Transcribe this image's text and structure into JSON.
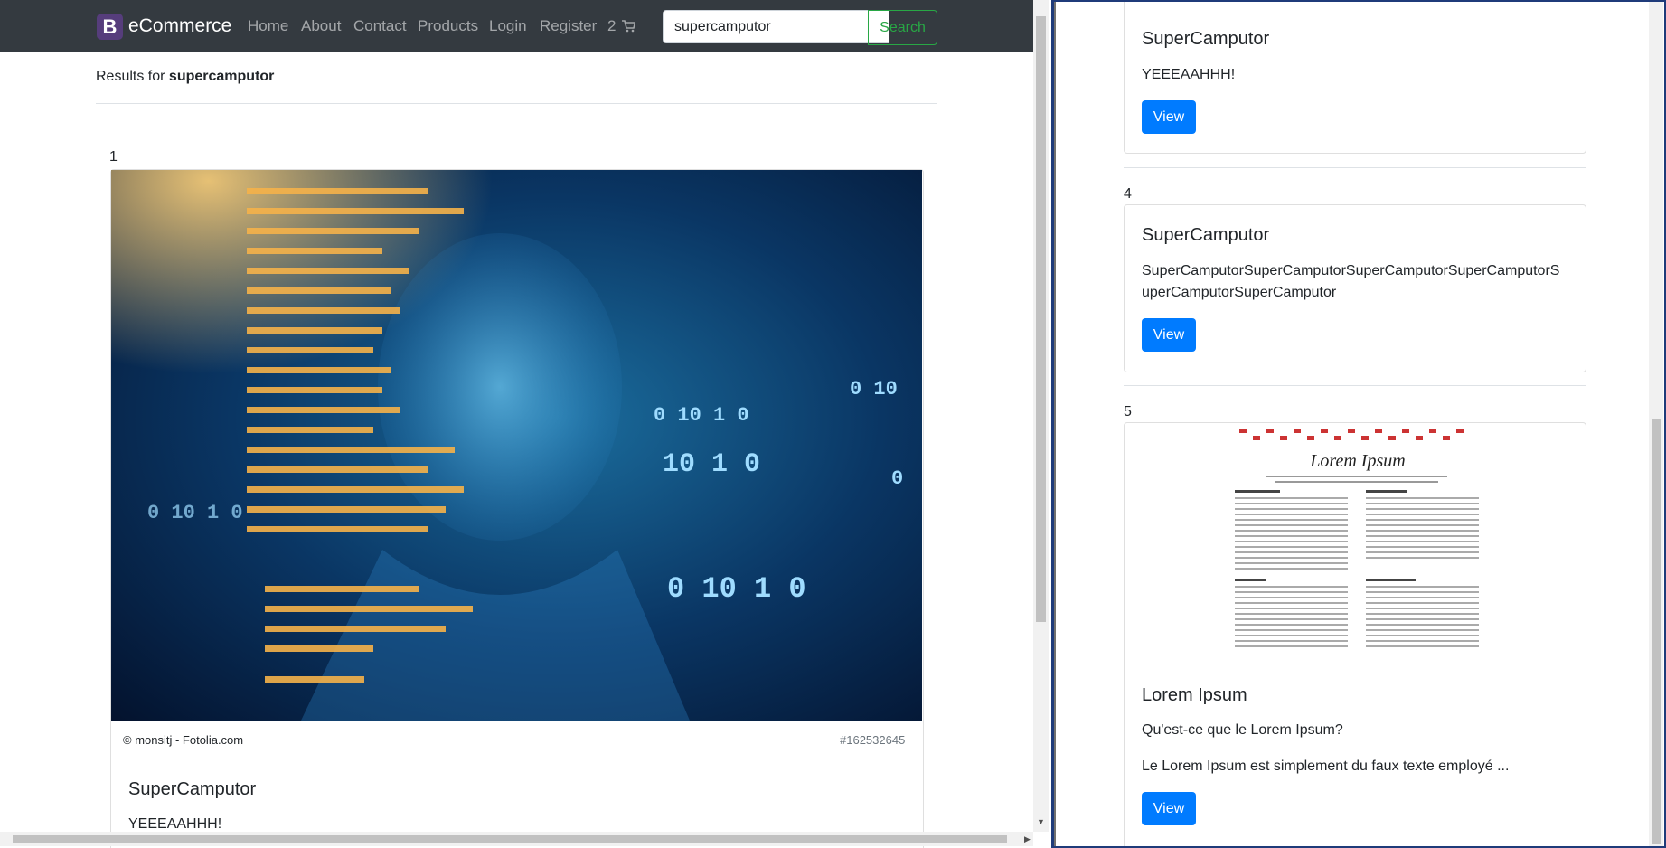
{
  "navbar": {
    "brand_letter": "B",
    "brand_name": "eCommerce",
    "links": [
      "Home",
      "About",
      "Contact",
      "Products",
      "Login",
      "Register"
    ],
    "cart_count": "2",
    "search_value": "supercamputor",
    "search_button": "Search"
  },
  "results": {
    "prefix": "Results for ",
    "query": "supercamputor"
  },
  "left_items": [
    {
      "number": "1",
      "image": "ai-head-code-photo",
      "caption_left": "© monsitj - Fotolia.com",
      "caption_right": "#162532645",
      "title": "SuperCamputor",
      "text": "YEEEAAHHH!"
    }
  ],
  "right_items": [
    {
      "title": "SuperCamputor",
      "text": "YEEEAAHHH!",
      "button": "View"
    },
    {
      "number": "4",
      "title": "SuperCamputor",
      "text": "SuperCamputorSuperCamputorSuperCamputorSuperCamputorS uperCamputorSuperCamputor",
      "button": "View"
    },
    {
      "number": "5",
      "image": "lorem-ipsum-document",
      "image_title": "Lorem Ipsum",
      "title": "Lorem Ipsum",
      "text1": "Qu'est-ce que le Lorem Ipsum?",
      "text2": "Le Lorem Ipsum est simplement du faux texte employé ...",
      "button": "View"
    }
  ],
  "colors": {
    "navbar": "#343a40",
    "primary": "#007bff",
    "success": "#28a745",
    "brand": "#563d7c"
  }
}
